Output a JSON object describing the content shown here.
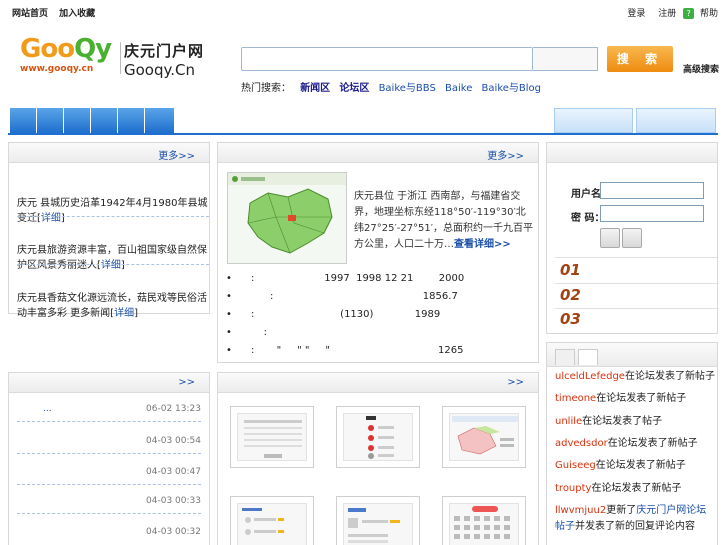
{
  "topbar": {
    "left": [
      "网站首页",
      "加入收藏"
    ],
    "right": [
      "登录",
      "注册",
      "帮助"
    ],
    "help_icon": "?"
  },
  "header": {
    "logo_text_a": "Goo",
    "logo_text_b": "Qy",
    "logo_url": "www.gooqy.cn",
    "site_name_cn": "庆元门户网",
    "site_name_en": "Gooqy.Cn",
    "search_placeholder": "",
    "search_button": "搜 索",
    "advanced_search": "高级搜索",
    "search_tabs_prefix": "热门搜索：",
    "search_tabs": [
      "新闻区",
      "论坛区",
      "Baike与BBS",
      "Baike",
      "Baike与Blog"
    ]
  },
  "news": {
    "more": "更多>>",
    "items": [
      {
        "text": "庆元 县城历史沿革1942年4月1980年县城变迁[",
        "link": "详细",
        "end": "]"
      },
      {
        "text": "庆元县旅游资源丰富，百山祖国家级自然保护区风景秀丽迷人[",
        "link": "详细",
        "end": "]"
      },
      {
        "text": "庆元县香菇文化源远流长，菇民戏等民俗活动丰富多彩 更多新闻[",
        "link": "详细",
        "end": "]"
      }
    ]
  },
  "intro": {
    "more": "更多>>",
    "text": "庆元县位 于浙江 西南部，与福建省交界，地理坐标东经118°50′-119°30′北纬27°25′-27°51′，总面积约一千九百平方公里，人口二十万…",
    "link": "查看详细>>",
    "bullets": [
      "•      :                      1997  1998 12 21        2000",
      "•            :                                               1856.7",
      "•      :                           (1130)             1989",
      "•          :",
      "•      :       \"     \" \"     \"                                  1265"
    ]
  },
  "login": {
    "user_label": "用户名：",
    "pass_label": "密 码：",
    "ranks": [
      "01",
      "02",
      "03"
    ]
  },
  "latest": {
    "more": ">>",
    "rows": [
      {
        "title": "...",
        "time": "06-02 13:23"
      },
      {
        "title": "",
        "time": "04-03 00:54"
      },
      {
        "title": "",
        "time": "04-03 00:47"
      },
      {
        "title": "",
        "time": "04-03 00:33"
      },
      {
        "title": "",
        "time": "04-03 00:32"
      }
    ]
  },
  "gallery": {
    "more": ">>"
  },
  "activity": {
    "rows": [
      {
        "user": "ulceldLefedge",
        "action": "在论坛发表了新帖子"
      },
      {
        "user": "timeone",
        "action": "在论坛发表了新帖子"
      },
      {
        "user": "unlile",
        "action": "在论坛发表了帖子"
      },
      {
        "user": "advedsdor",
        "action": "在论坛发表了新帖子"
      },
      {
        "user": "Guiseeg",
        "action": "在论坛发表了新帖子"
      },
      {
        "user": "troupty",
        "action": "在论坛发表了新帖子"
      },
      {
        "user": "llwvmjuu2",
        "action": "更新了",
        "link": "庆元门户网论坛帖子",
        "tail": "并发表了新的回复评论内容"
      }
    ]
  }
}
